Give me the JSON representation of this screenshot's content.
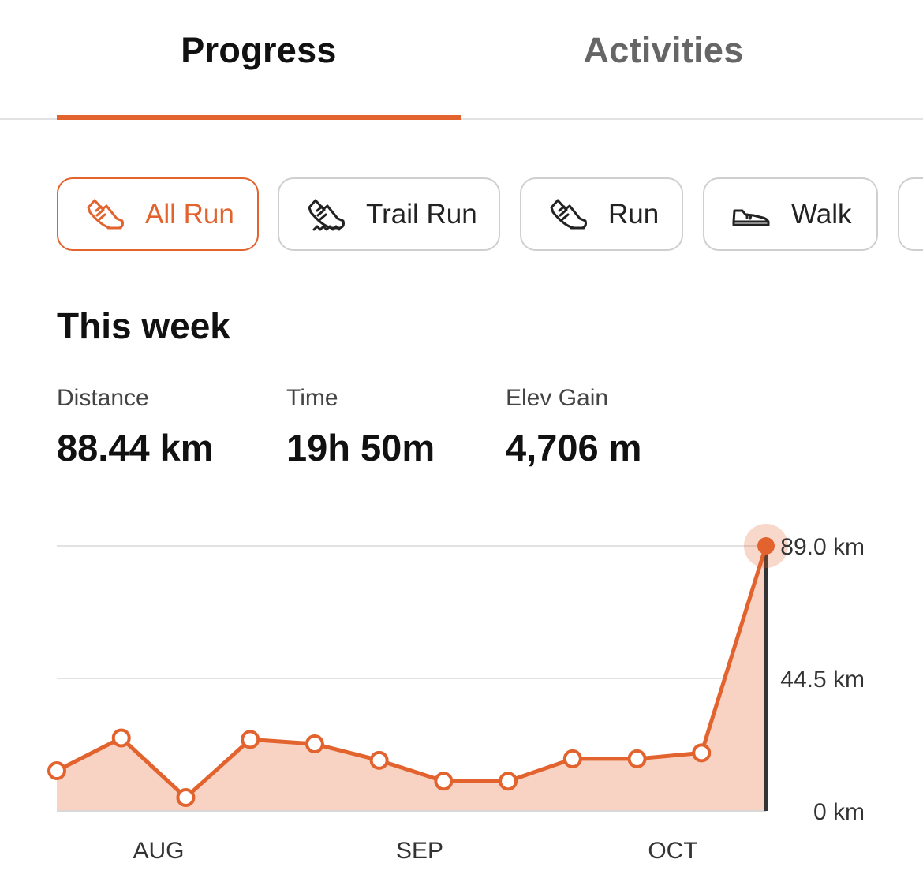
{
  "tabs": {
    "progress": "Progress",
    "activities": "Activities"
  },
  "filters": [
    {
      "label": "All Run",
      "icon": "running-shoe-icon",
      "active": true
    },
    {
      "label": "Trail Run",
      "icon": "trail-shoe-icon",
      "active": false
    },
    {
      "label": "Run",
      "icon": "running-shoe-icon",
      "active": false
    },
    {
      "label": "Walk",
      "icon": "walking-shoe-icon",
      "active": false
    }
  ],
  "week": {
    "title": "This week",
    "stats": [
      {
        "label": "Distance",
        "value": "88.44 km"
      },
      {
        "label": "Time",
        "value": "19h 50m"
      },
      {
        "label": "Elev Gain",
        "value": "4,706 m"
      }
    ]
  },
  "colors": {
    "accent": "#e2632e",
    "accent_fill": "#f8d2c3",
    "grid": "#e2e2e2"
  },
  "chart_data": {
    "type": "area",
    "x_ticks": [
      "AUG",
      "SEP",
      "OCT"
    ],
    "y_ticks": [
      "0 km",
      "44.5 km",
      "89.0 km"
    ],
    "ylim": [
      0,
      89
    ],
    "y_unit": "km",
    "values": [
      13.5,
      24.5,
      4.5,
      24,
      22.5,
      17,
      10,
      10,
      17.5,
      17.5,
      19.5,
      89
    ],
    "highlight_index": 11,
    "grid": true
  }
}
